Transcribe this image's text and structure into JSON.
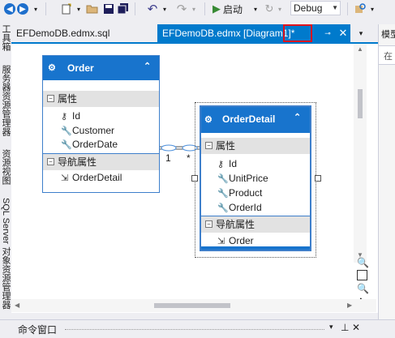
{
  "toolbar": {
    "start_label": "启动",
    "configuration": "Debug"
  },
  "left_tabs": [
    "工具箱",
    "服务器资源管理器",
    "资源视图",
    "SQL Server 对象资源管理器"
  ],
  "tabs": [
    {
      "label": "EFDemoDB.edmx.sql"
    },
    {
      "label": "EFDemoDB.edmx [Diagram1]*"
    }
  ],
  "diagram": {
    "entities": [
      {
        "name": "Order",
        "properties_label": "属性",
        "properties": [
          "Id",
          "Customer",
          "OrderDate"
        ],
        "nav_label": "导航属性",
        "nav": [
          "OrderDetail"
        ]
      },
      {
        "name": "OrderDetail",
        "properties_label": "属性",
        "properties": [
          "Id",
          "UnitPrice",
          "Product",
          "OrderId"
        ],
        "nav_label": "导航属性",
        "nav": [
          "Order"
        ]
      }
    ],
    "association": {
      "left_multiplicity": "1",
      "right_multiplicity": "*"
    }
  },
  "right_panel": {
    "title": "模型",
    "search": "在"
  },
  "bottom": {
    "title": "命令窗口"
  }
}
